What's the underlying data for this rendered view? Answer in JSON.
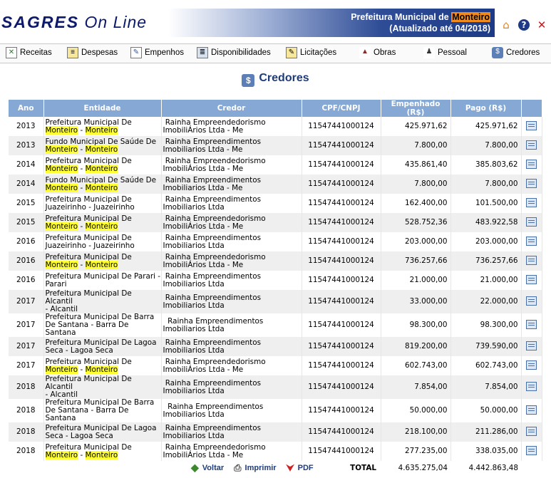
{
  "header": {
    "logo_bold": "SAGRES",
    "logo_rest": "On Line",
    "banner_prefix": "Prefeitura Municipal de ",
    "banner_highlight": "Monteiro",
    "banner_updated": "(Atualizado até 04/2018)",
    "icons": [
      "home-icon",
      "help-icon",
      "close-icon"
    ]
  },
  "nav": [
    {
      "label": "Receitas",
      "icon": "receitas-icon"
    },
    {
      "label": "Despesas",
      "icon": "despesas-icon"
    },
    {
      "label": "Empenhos",
      "icon": "empenhos-icon"
    },
    {
      "label": "Disponibilidades",
      "icon": "disponibilidades-icon"
    },
    {
      "label": "Licitações",
      "icon": "licitacoes-icon"
    },
    {
      "label": "Obras",
      "icon": "obras-icon"
    },
    {
      "label": "Pessoal",
      "icon": "pessoal-icon"
    },
    {
      "label": "Credores",
      "icon": "credores-icon"
    }
  ],
  "page_title": "Credores",
  "table": {
    "columns": [
      "Ano",
      "Entidade",
      "Credor",
      "CPF/CNPJ",
      "Empenhado (R$)",
      "Pago (R$)",
      ""
    ],
    "rows": [
      {
        "ano": "2013",
        "e1": "Prefeitura Municipal De",
        "e2a": "Monteiro",
        "e2s": " - ",
        "e2b": "Monteiro",
        "c1": " Rainha Empreendedorismo",
        "c2": "ImobiliÁrios Ltda - Me",
        "cpf": "11547441000124",
        "emp": "425.971,62",
        "pago": "425.971,62"
      },
      {
        "ano": "2013",
        "e1": "Fundo Municipal De Saúde De",
        "e2a": "Monteiro",
        "e2s": " - ",
        "e2b": "Monteiro",
        "c1": " Rainha Empreendimentos",
        "c2": "Imobiliarios Ltda - Me",
        "cpf": "11547441000124",
        "emp": "7.800,00",
        "pago": "7.800,00"
      },
      {
        "ano": "2014",
        "e1": "Prefeitura Municipal De",
        "e2a": "Monteiro",
        "e2s": " - ",
        "e2b": "Monteiro",
        "c1": " Rainha Empreendedorismo",
        "c2": "ImobiliÁrios Ltda - Me",
        "cpf": "11547441000124",
        "emp": "435.861,40",
        "pago": "385.803,62"
      },
      {
        "ano": "2014",
        "e1": "Fundo Municipal De Saúde De",
        "e2a": "Monteiro",
        "e2s": " - ",
        "e2b": "Monteiro",
        "c1": " Rainha Empreendimentos",
        "c2": "Imobiliarios Ltda - Me",
        "cpf": "11547441000124",
        "emp": "7.800,00",
        "pago": "7.800,00"
      },
      {
        "ano": "2015",
        "e1": "Prefeitura Municipal De",
        "e2a": "",
        "e2s": "Juazeirinho - Juazeirinho",
        "e2b": "",
        "c1": " Rainha Empreendimentos",
        "c2": "Imobiliarios Ltda",
        "cpf": "11547441000124",
        "emp": "162.400,00",
        "pago": "101.500,00"
      },
      {
        "ano": "2015",
        "e1": "Prefeitura Municipal De",
        "e2a": "Monteiro",
        "e2s": " - ",
        "e2b": "Monteiro",
        "c1": " Rainha Empreendedorismo",
        "c2": "ImobiliÁrios Ltda - Me",
        "cpf": "11547441000124",
        "emp": "528.752,36",
        "pago": "483.922,58"
      },
      {
        "ano": "2016",
        "e1": "Prefeitura Municipal De",
        "e2a": "",
        "e2s": "Juazeirinho - Juazeirinho",
        "e2b": "",
        "c1": " Rainha Empreendimentos",
        "c2": "Imobiliarios Ltda",
        "cpf": "11547441000124",
        "emp": "203.000,00",
        "pago": "203.000,00"
      },
      {
        "ano": "2016",
        "e1": "Prefeitura Municipal De",
        "e2a": "Monteiro",
        "e2s": " - ",
        "e2b": "Monteiro",
        "c1": " Rainha Empreendedorismo",
        "c2": "ImobiliÁrios Ltda - Me",
        "cpf": "11547441000124",
        "emp": "736.257,66",
        "pago": "736.257,66"
      },
      {
        "ano": "2016",
        "e1": "Prefeitura Municipal De Parari -",
        "e2a": "",
        "e2s": "Parari",
        "e2b": "",
        "c1": " Rainha Empreendimentos",
        "c2": "Imobiliarios Ltda",
        "cpf": "11547441000124",
        "emp": "21.000,00",
        "pago": "21.000,00"
      },
      {
        "ano": "2017",
        "e1": "Prefeitura Municipal De Alcantil",
        "e2a": "",
        "e2s": "- Alcantil",
        "e2b": "",
        "c1": " Rainha Empreendimentos",
        "c2": "Imobiliarios Ltda",
        "cpf": "11547441000124",
        "emp": "33.000,00",
        "pago": "22.000,00"
      },
      {
        "ano": "2017",
        "e1": "Prefeitura Municipal De Barra",
        "e2a": "",
        "e2s": "De Santana - Barra De Santana",
        "e2b": "",
        "c1": "  Rainha Empreendimentos",
        "c2": "Imobiliarios Ltda",
        "cpf": "11547441000124",
        "emp": "98.300,00",
        "pago": "98.300,00"
      },
      {
        "ano": "2017",
        "e1": "Prefeitura Municipal De Lagoa",
        "e2a": "",
        "e2s": "Seca - Lagoa Seca",
        "e2b": "",
        "c1": " Rainha Empreendimentos",
        "c2": "Imobiliarios Ltda",
        "cpf": "11547441000124",
        "emp": "819.200,00",
        "pago": "739.590,00"
      },
      {
        "ano": "2017",
        "e1": "Prefeitura Municipal De",
        "e2a": "Monteiro",
        "e2s": " - ",
        "e2b": "Monteiro",
        "c1": " Rainha Empreendedorismo",
        "c2": "ImobiliÁrios Ltda - Me",
        "cpf": "11547441000124",
        "emp": "602.743,00",
        "pago": "602.743,00"
      },
      {
        "ano": "2018",
        "e1": "Prefeitura Municipal De Alcantil",
        "e2a": "",
        "e2s": "- Alcantil",
        "e2b": "",
        "c1": " Rainha Empreendimentos",
        "c2": "Imobiliarios Ltda",
        "cpf": "11547441000124",
        "emp": "7.854,00",
        "pago": "7.854,00"
      },
      {
        "ano": "2018",
        "e1": "Prefeitura Municipal De Barra",
        "e2a": "",
        "e2s": "De Santana - Barra De Santana",
        "e2b": "",
        "c1": "  Rainha Empreendimentos",
        "c2": "Imobiliarios Ltda",
        "cpf": "11547441000124",
        "emp": "50.000,00",
        "pago": "50.000,00"
      },
      {
        "ano": "2018",
        "e1": "Prefeitura Municipal De Lagoa",
        "e2a": "",
        "e2s": "Seca - Lagoa Seca",
        "e2b": "",
        "c1": " Rainha Empreendimentos",
        "c2": "Imobiliarios Ltda",
        "cpf": "11547441000124",
        "emp": "218.100,00",
        "pago": "211.286,00"
      },
      {
        "ano": "2018",
        "e1": "Prefeitura Municipal De",
        "e2a": "Monteiro",
        "e2s": " - ",
        "e2b": "Monteiro",
        "c1": " Rainha Empreendedorismo",
        "c2": "ImobiliÁrios Ltda - Me",
        "cpf": "11547441000124",
        "emp": "277.235,00",
        "pago": "338.035,00"
      }
    ],
    "total_label": "TOTAL",
    "total_empenhado": "4.635.275,04",
    "total_pago": "4.442.863,48"
  },
  "footer": {
    "voltar": "Voltar",
    "imprimir": "Imprimir",
    "pdf": "PDF"
  }
}
